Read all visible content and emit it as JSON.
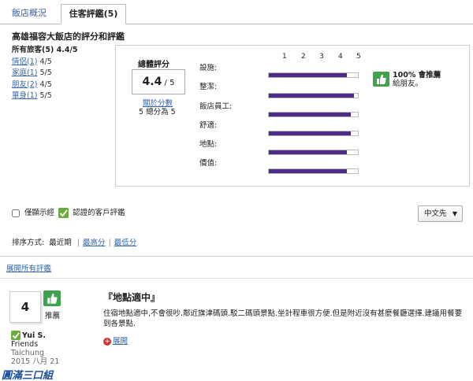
{
  "tabs": [
    {
      "label": "飯店概況"
    },
    {
      "label": "住客評鑑(5)"
    }
  ],
  "heading": "高雄福容大飯店的評分和評鑑",
  "travelers": {
    "all_label": "所有旅客(5)",
    "all_value": "4.4/5",
    "groups": [
      {
        "label": "情侶(1)",
        "value": "4/5"
      },
      {
        "label": "家庭(1)",
        "value": "5/5"
      },
      {
        "label": "朋友(2)",
        "value": "4/5"
      },
      {
        "label": "單身(1)",
        "value": "5/5"
      }
    ]
  },
  "overall": {
    "label": "總體評分",
    "score": "4.4",
    "out_of": "/ 5",
    "scale_link": "關於分數",
    "scale_note": "5 總分為 5"
  },
  "scale_numbers": [
    "1",
    "2",
    "3",
    "4",
    "5"
  ],
  "categories": [
    {
      "label": "設施:",
      "value": 4.4
    },
    {
      "label": "整潔:",
      "value": 4.8
    },
    {
      "label": "飯店員工:",
      "value": 4.6
    },
    {
      "label": "舒適:",
      "value": 4.6
    },
    {
      "label": "地點:",
      "value": 4.4
    },
    {
      "label": "價值:",
      "value": 4.4
    }
  ],
  "recommend": {
    "percent": "100% 會推薦",
    "to": "給朋友。"
  },
  "filter": {
    "prefix": "僅顯示經",
    "suffix": "認證的客戶評鑑"
  },
  "language": {
    "selected": "中文先"
  },
  "sort": {
    "label": "排序方式:",
    "current": "最近期",
    "options": [
      "最高分",
      "最低分"
    ]
  },
  "expand_all": "展開所有評鑑",
  "review": {
    "score": "4",
    "recommend_label": "推薦",
    "reviewer_name": "Yui S.",
    "reviewer_group": "Friends",
    "reviewer_city": "Taichung",
    "date": "2015 八月 21",
    "title": "『地點適中』",
    "body": "住宿地點適中,不會很吵.鄰近旗津碼頭.駁二碼頭景點.坐計程車很方便.但是附近沒有甚麼餐廳選擇.建議用餐要到各景點.",
    "expand": "展開"
  },
  "watermark": "圓滿三口組",
  "colors": {
    "bar": "#4b2b85",
    "recommend": "#3fa34d",
    "link": "#3366aa"
  }
}
